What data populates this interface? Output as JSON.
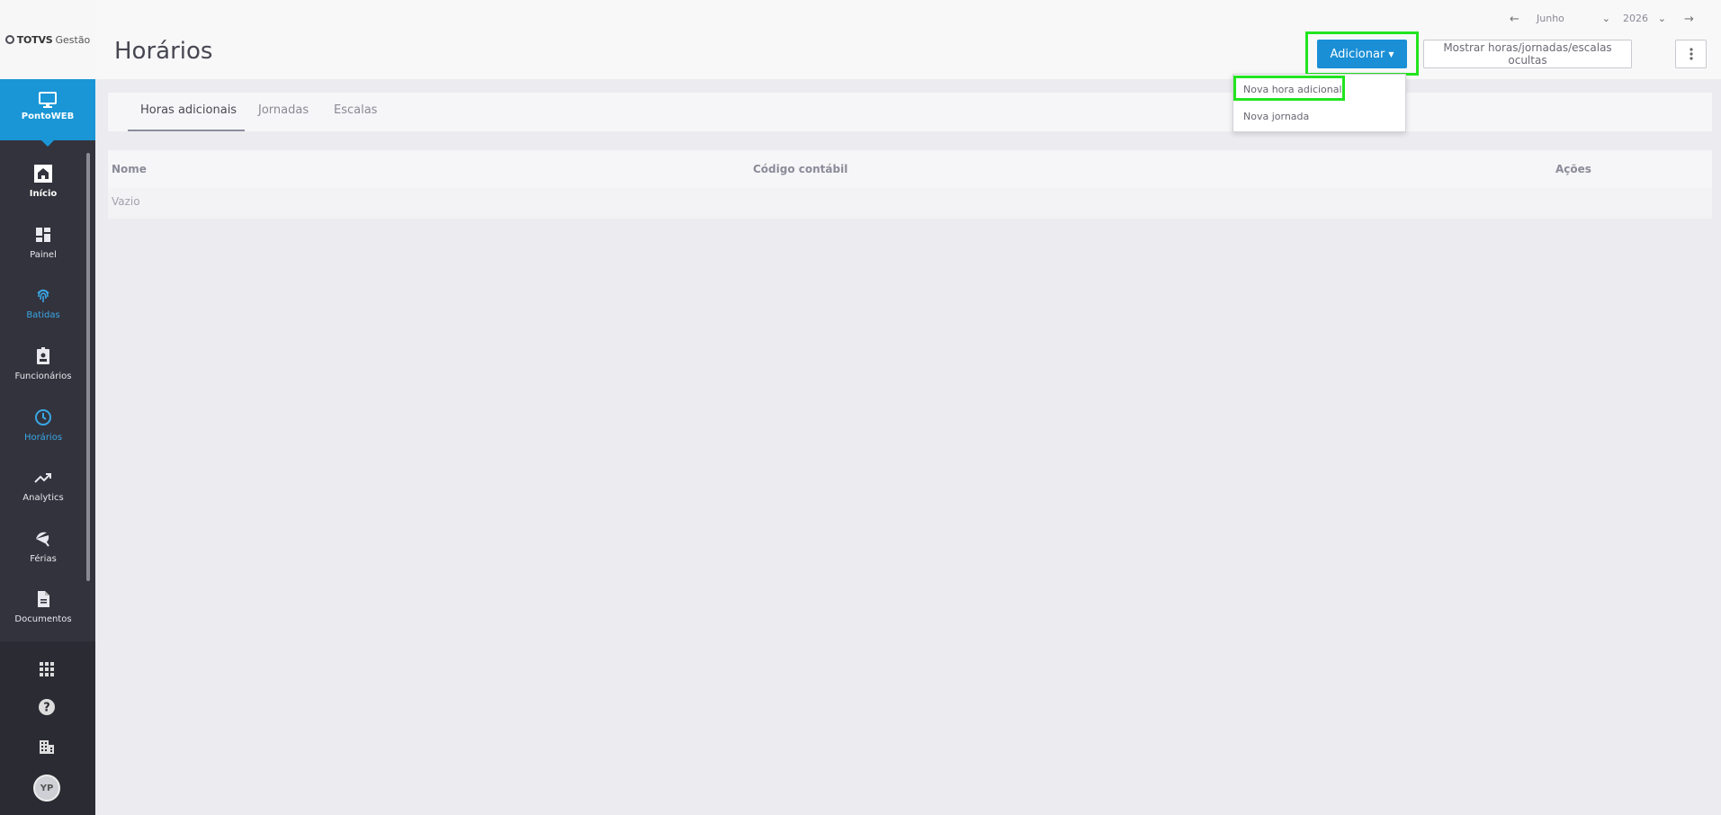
{
  "brand": {
    "name": "TOTVS",
    "product": "Gestão"
  },
  "module": {
    "label": "PontoWEB",
    "icon": "monitor-icon"
  },
  "nav": [
    {
      "label": "Início",
      "icon": "home-icon"
    },
    {
      "label": "Painel",
      "icon": "dashboard-icon"
    },
    {
      "label": "Batidas",
      "icon": "fingerprint-icon"
    },
    {
      "label": "Funcionários",
      "icon": "badge-icon"
    },
    {
      "label": "Horários",
      "icon": "clock-icon"
    },
    {
      "label": "Analytics",
      "icon": "trending-up-icon"
    },
    {
      "label": "Férias",
      "icon": "beach-umbrella-icon"
    },
    {
      "label": "Documentos",
      "icon": "document-icon"
    }
  ],
  "bottom_icons": [
    "apps-grid-icon",
    "help-icon",
    "building-icon"
  ],
  "user": {
    "initials": "YP"
  },
  "header": {
    "title": "Horários",
    "month": "Junho",
    "year": "2026",
    "add_label": "Adicionar",
    "show_hidden_label": "Mostrar horas/jornadas/escalas ocultas"
  },
  "tabs": [
    {
      "label": "Horas adicionais",
      "active": true
    },
    {
      "label": "Jornadas",
      "active": false
    },
    {
      "label": "Escalas",
      "active": false
    }
  ],
  "table": {
    "columns": [
      "Nome",
      "Código contábil",
      "Ações"
    ],
    "empty_text": "Vazio"
  },
  "dropdown": {
    "items": [
      "Nova hora adicional",
      "Nova jornada"
    ]
  },
  "colors": {
    "accent": "#1a8fd6",
    "sidebar": "#33333d",
    "highlight": "#22e41f"
  }
}
